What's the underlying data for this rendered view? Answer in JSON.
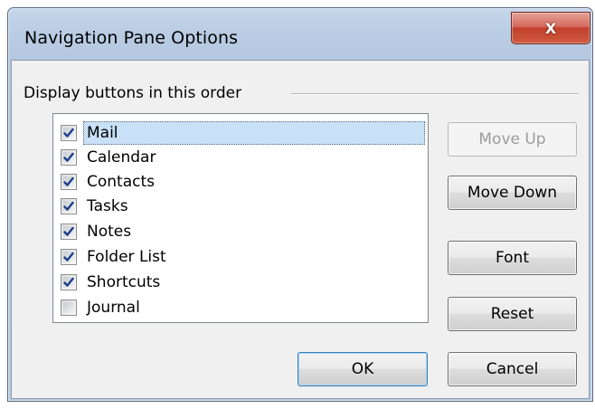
{
  "window": {
    "title": "Navigation Pane Options",
    "close_glyph": "X"
  },
  "group": {
    "label": "Display buttons in this order"
  },
  "items": [
    {
      "label": "Mail",
      "checked": true,
      "selected": true
    },
    {
      "label": "Calendar",
      "checked": true,
      "selected": false
    },
    {
      "label": "Contacts",
      "checked": true,
      "selected": false
    },
    {
      "label": "Tasks",
      "checked": true,
      "selected": false
    },
    {
      "label": "Notes",
      "checked": true,
      "selected": false
    },
    {
      "label": "Folder List",
      "checked": true,
      "selected": false
    },
    {
      "label": "Shortcuts",
      "checked": true,
      "selected": false
    },
    {
      "label": "Journal",
      "checked": false,
      "selected": false
    }
  ],
  "buttons": {
    "move_up": "Move Up",
    "move_down": "Move Down",
    "font": "Font",
    "reset": "Reset",
    "ok": "OK",
    "cancel": "Cancel"
  },
  "icons": {
    "close": "close-icon",
    "check": "checkmark-icon"
  },
  "colors": {
    "selection": "#c9e1f6",
    "close_button": "#c23f2c",
    "check": "#1c3e8a"
  }
}
